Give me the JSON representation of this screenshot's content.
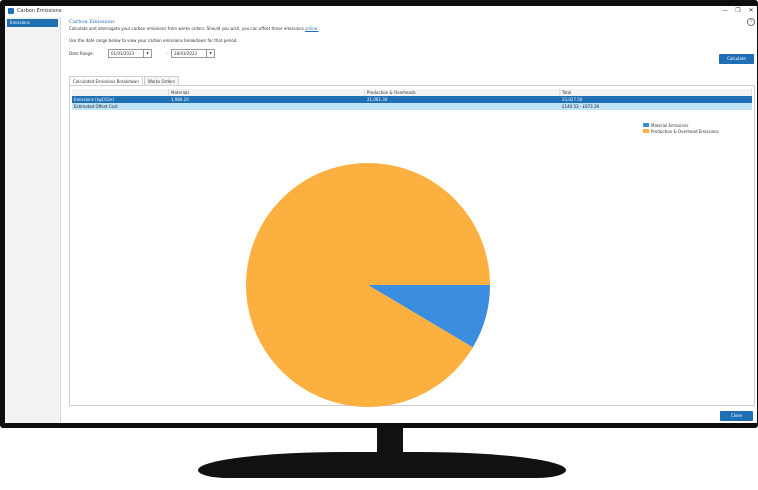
{
  "window": {
    "title": "Carbon Emissions",
    "minimize": "—",
    "maximize": "❐",
    "close": "✕",
    "help": "?"
  },
  "sidebar": {
    "items": [
      {
        "label": "Emissions"
      }
    ]
  },
  "header": {
    "title": "Carbon Emissions",
    "description": "Calculate and interrogate your carbon emissions from works orders. Should you wish, you can offset these emissions",
    "link": "online.",
    "subtitle": "Use the date range below to view your carbon emissions breakdown for that period."
  },
  "date_range": {
    "label": "Date Range:",
    "start": "01/03/2023",
    "end": "28/03/2023",
    "separator": "-"
  },
  "buttons": {
    "calculate": "Calculate",
    "close": "Close"
  },
  "tabs": [
    {
      "label": "Calculated Emissions Breakdown",
      "active": true
    },
    {
      "label": "Works Orders",
      "active": false
    }
  ],
  "table": {
    "headers": [
      "",
      "Materials",
      "Production & Overheads",
      "Total"
    ],
    "rows": [
      {
        "cells": [
          "Emissions (kgCO2e)",
          "1,966.20",
          "21,061.30",
          "23,027.50"
        ],
        "selected": true
      },
      {
        "cells": [
          "Estimated Offset Cost",
          "",
          "",
          "£140.53 - £673.39"
        ],
        "selected": false
      }
    ]
  },
  "chart_data": {
    "type": "pie",
    "labels": [
      "Material Emissions",
      "Production & Overhead Emissions"
    ],
    "values": [
      1966.2,
      21061.3
    ],
    "colors": [
      "#3b8de0",
      "#fbb040"
    ],
    "legend": "top-right"
  },
  "colors": {
    "accent": "#1f6fb5",
    "selected_row": "#1f6fb5",
    "second_row": "#bfe3f7"
  }
}
